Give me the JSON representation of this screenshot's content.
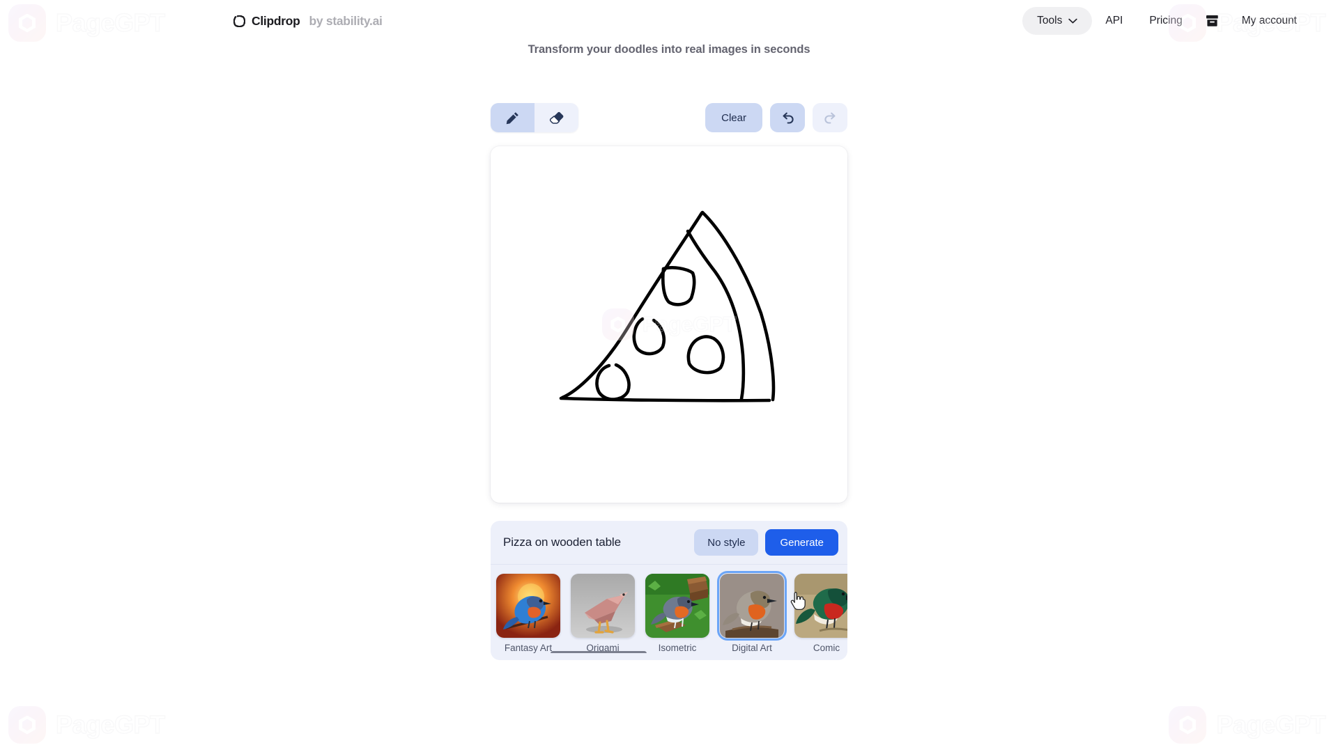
{
  "watermark": {
    "text": "PageGPT",
    "icon": "hexagon-logo-icon"
  },
  "header": {
    "brand": {
      "mark_icon": "clipdrop-dashed-circle-icon",
      "name": "Clipdrop",
      "subtitle": "by stability.ai"
    },
    "nav": {
      "tools_label": "Tools",
      "tools_chevron_icon": "chevron-down-icon",
      "api_label": "API",
      "pricing_label": "Pricing",
      "archive_icon": "archive-box-icon",
      "account_label": "My account"
    }
  },
  "tagline": "Transform your doodles into real images in seconds",
  "toolbar": {
    "pen_icon": "pencil-icon",
    "pen_active": true,
    "eraser_icon": "eraser-icon",
    "eraser_active": false,
    "clear_label": "Clear",
    "undo_icon": "undo-arrow-icon",
    "undo_enabled": true,
    "redo_icon": "redo-arrow-icon",
    "redo_enabled": false
  },
  "canvas": {
    "drawing_description": "hand-drawn pizza slice doodle with crust and toppings",
    "stroke_color": "#000000",
    "background": "#ffffff"
  },
  "prompt": {
    "value": "Pizza on wooden table",
    "placeholder": "Describe your drawing",
    "style_button_label": "No style",
    "generate_label": "Generate"
  },
  "styles": {
    "selected": "Digital Art",
    "items": [
      {
        "label": "Fantasy Art",
        "selected": false
      },
      {
        "label": "Origami",
        "selected": false
      },
      {
        "label": "Isometric",
        "selected": false
      },
      {
        "label": "Digital Art",
        "selected": true
      },
      {
        "label": "Comic",
        "selected": false
      }
    ]
  },
  "colors": {
    "accent_blue": "#1e5eea",
    "soft_blue": "#ccd8f3",
    "panel_blue": "#edf0fa",
    "selected_ring": "#6ba5f7"
  },
  "cursor": {
    "type": "pointing-hand"
  }
}
